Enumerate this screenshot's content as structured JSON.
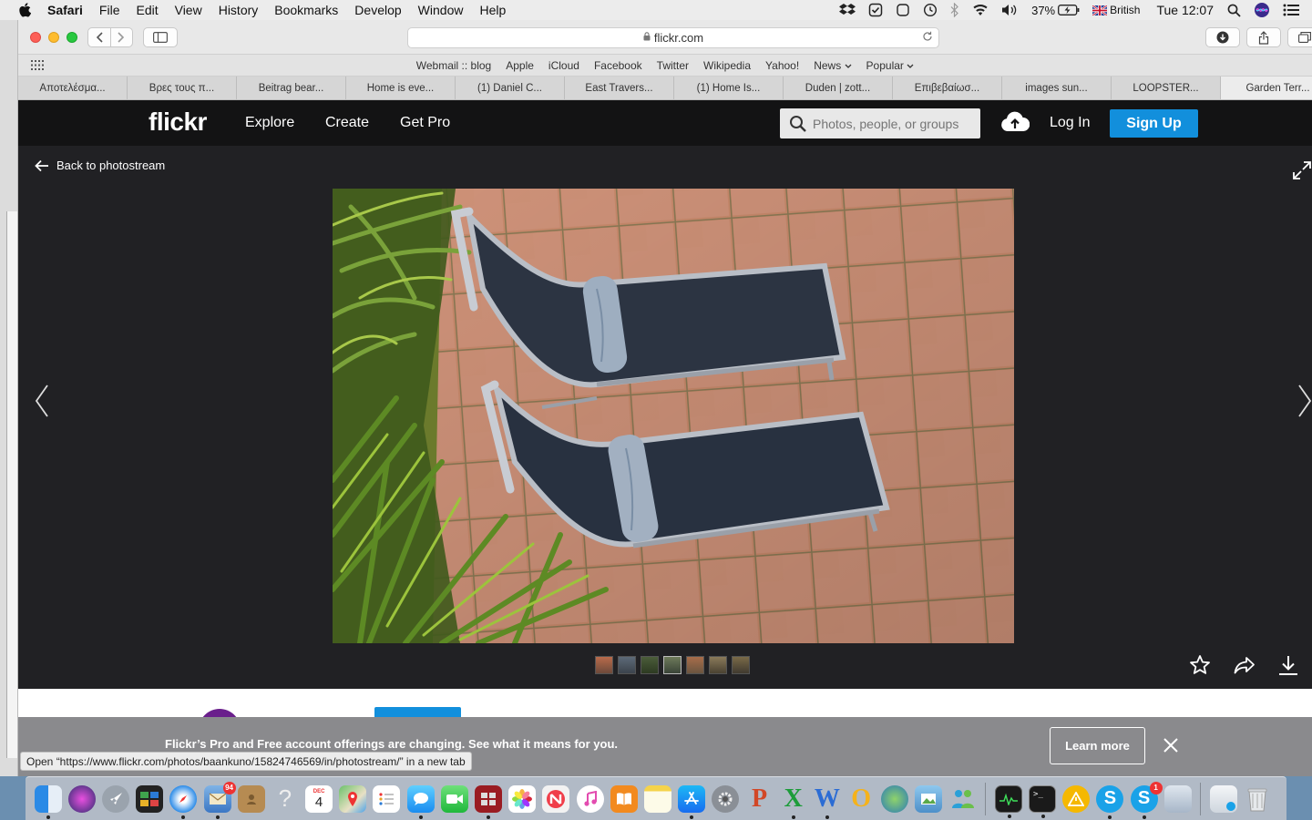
{
  "menubar": {
    "app_name": "Safari",
    "items": [
      "File",
      "Edit",
      "View",
      "History",
      "Bookmarks",
      "Develop",
      "Window",
      "Help"
    ],
    "battery": "37%",
    "input_source": "British",
    "clock": "Tue 12:07"
  },
  "browser": {
    "address": "flickr.com",
    "favorites": [
      "Webmail :: blog",
      "Apple",
      "iCloud",
      "Facebook",
      "Twitter",
      "Wikipedia",
      "Yahoo!",
      "News",
      "Popular"
    ],
    "tabs": [
      "Αποτελέσμα...",
      "Βρες τους π...",
      "Beitrag bear...",
      "Home is eve...",
      "(1) Daniel C...",
      "East Travers...",
      "(1) Home Is...",
      "Duden | zott...",
      "Επιβεβαίωσ...",
      "images sun...",
      "LOOPSTER...",
      "Garden Terr..."
    ],
    "active_tab_index": 11,
    "status_text": "Open “https://www.flickr.com/photos/baankuno/15824746569/in/photostream/” in a new tab"
  },
  "flickr": {
    "logo": "flickr",
    "nav": {
      "explore": "Explore",
      "create": "Create",
      "get_pro": "Get Pro"
    },
    "search_placeholder": "Photos, people, or groups",
    "login": "Log In",
    "signup": "Sign Up",
    "back_link": "Back to photostream",
    "banner_text": "Flickr’s Pro and Free account offerings are changing. See what it means for you.",
    "learn_more": "Learn more"
  },
  "colors": {
    "flickr_blue": "#128fdc",
    "header_bg": "#131314",
    "viewer_bg": "#212124",
    "banner_bg": "#8a8a8d"
  },
  "dock": {
    "mail_badge": "94",
    "skype_badge": "1",
    "calendar_day": "4",
    "calendar_month": "DEC"
  }
}
